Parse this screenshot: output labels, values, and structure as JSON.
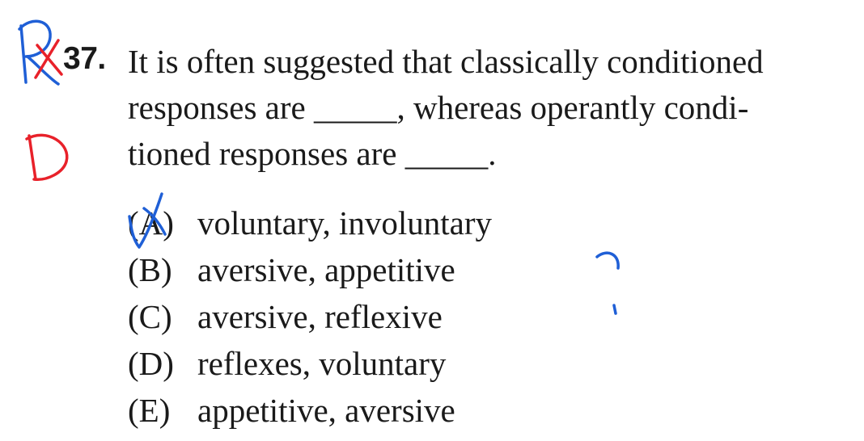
{
  "question": {
    "number": "37.",
    "stem_lines": [
      "It is often suggested that classically conditioned",
      "responses are _____, whereas operantly condi-",
      "tioned responses are _____."
    ]
  },
  "choices": [
    {
      "label": "(A)",
      "text": "voluntary, involuntary"
    },
    {
      "label": "(B)",
      "text": "aversive, appetitive"
    },
    {
      "label": "(C)",
      "text": "aversive, reflexive"
    },
    {
      "label": "(D)",
      "text": "reflexes, voluntary"
    },
    {
      "label": "(E)",
      "text": "appetitive, aversive"
    }
  ],
  "annotations": {
    "red_answer": "D",
    "red_color": "#e8212a",
    "blue_color": "#1f5fd6"
  }
}
